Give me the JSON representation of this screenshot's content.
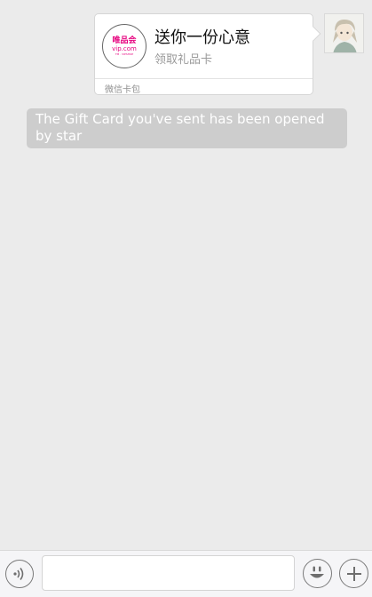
{
  "gift_card": {
    "title": "送你一份心意",
    "subtitle": "领取礼品卡",
    "footer": "微信卡包",
    "logo": {
      "brand_cn": "唯品会",
      "brand_url": "vip.com",
      "tagline": "TM · VIPSHOP"
    }
  },
  "system_message": "The Gift Card you've sent has been opened by star",
  "input_bar": {
    "text_value": "",
    "placeholder": ""
  },
  "icons": {
    "voice": "voice-icon",
    "emoji": "emoji-icon",
    "plus": "plus-icon",
    "avatar": "avatar-image"
  },
  "colors": {
    "brand_pink": "#e6007e",
    "background": "#ebebeb",
    "system_bubble": "#cdcdcd"
  }
}
